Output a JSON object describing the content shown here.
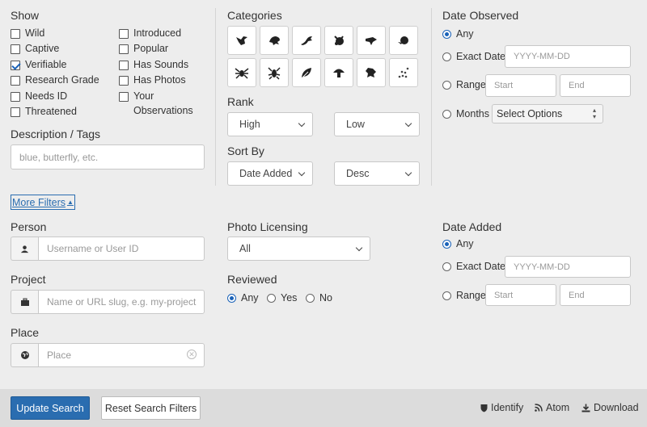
{
  "show": {
    "title": "Show",
    "options_left": [
      {
        "label": "Wild",
        "checked": false
      },
      {
        "label": "Captive",
        "checked": false
      },
      {
        "label": "Verifiable",
        "checked": true
      },
      {
        "label": "Research Grade",
        "checked": false
      },
      {
        "label": "Needs ID",
        "checked": false
      },
      {
        "label": "Threatened",
        "checked": false
      }
    ],
    "options_right": [
      {
        "label": "Introduced",
        "checked": false
      },
      {
        "label": "Popular",
        "checked": false
      },
      {
        "label": "Has Sounds",
        "checked": false
      },
      {
        "label": "Has Photos",
        "checked": false
      },
      {
        "label": "Your",
        "label2": "Observations",
        "checked": false
      }
    ]
  },
  "description": {
    "title": "Description / Tags",
    "placeholder": "blue, butterfly, etc."
  },
  "categories": {
    "title": "Categories",
    "icons": [
      "bird-icon",
      "amphibian-icon",
      "reptile-icon",
      "mammal-icon",
      "fish-icon",
      "mollusk-icon",
      "arachnid-icon",
      "insect-icon",
      "plant-icon",
      "fungi-icon",
      "protozoa-icon",
      "unknown-icon"
    ]
  },
  "rank": {
    "title": "Rank",
    "high": "High",
    "low": "Low"
  },
  "sort": {
    "title": "Sort By",
    "field": "Date Added",
    "order": "Desc"
  },
  "date_observed": {
    "title": "Date Observed",
    "any": "Any",
    "exact": "Exact Date",
    "exact_placeholder": "YYYY-MM-DD",
    "range": "Range",
    "start": "Start",
    "end": "End",
    "months": "Months",
    "months_select": "Select Options"
  },
  "more_filters": "More Filters",
  "person": {
    "title": "Person",
    "placeholder": "Username or User ID"
  },
  "project": {
    "title": "Project",
    "placeholder": "Name or URL slug, e.g. my-project"
  },
  "place": {
    "title": "Place",
    "placeholder": "Place"
  },
  "photo_licensing": {
    "title": "Photo Licensing",
    "value": "All"
  },
  "reviewed": {
    "title": "Reviewed",
    "any": "Any",
    "yes": "Yes",
    "no": "No"
  },
  "date_added": {
    "title": "Date Added",
    "any": "Any",
    "exact": "Exact Date",
    "exact_placeholder": "YYYY-MM-DD",
    "range": "Range",
    "start": "Start",
    "end": "End"
  },
  "footer": {
    "update": "Update Search",
    "reset": "Reset Search Filters",
    "identify": "Identify",
    "atom": "Atom",
    "download": "Download"
  },
  "colors": {
    "primary": "#2a6db0",
    "background": "#ededed",
    "footer": "#dcdcdc"
  }
}
